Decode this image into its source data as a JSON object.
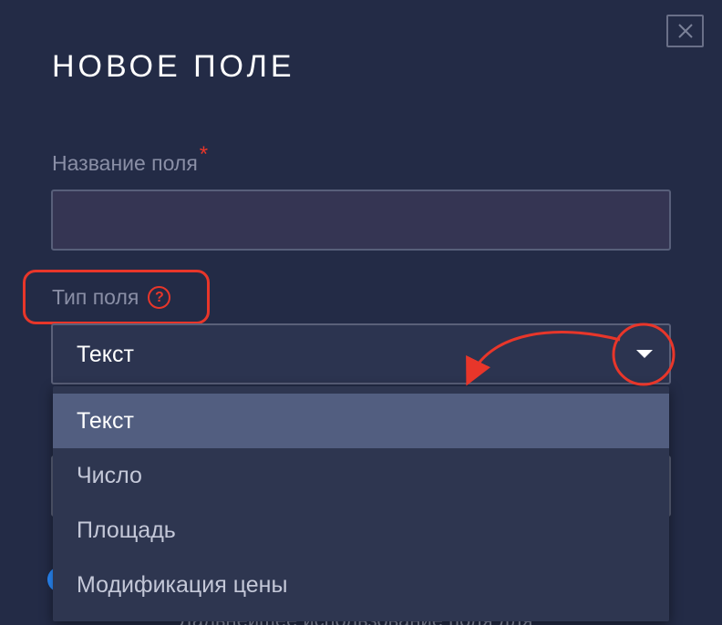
{
  "dialog": {
    "title": "НОВОЕ ПОЛЕ",
    "close_icon": "close-icon"
  },
  "name_field": {
    "label": "Название поля",
    "required_mark": "*",
    "value": ""
  },
  "type_field": {
    "label": "Тип поля",
    "help_icon": "question-circle-icon",
    "help_glyph": "?",
    "selected_value": "Текст",
    "options": [
      "Текст",
      "Число",
      "Площадь",
      "Модификация цены"
    ],
    "selected_index": 0
  },
  "background": {
    "partial_text": "Дальнейшее использование поля для"
  },
  "colors": {
    "background": "#232b46",
    "annotation": "#e8362a",
    "selected_option": "#525e80",
    "toggle": "#2a8cff"
  }
}
